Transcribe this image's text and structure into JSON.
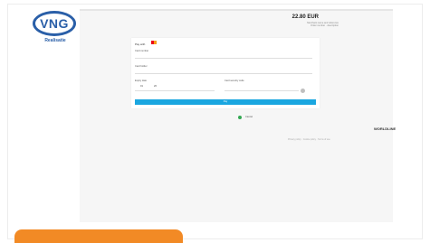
{
  "logo": {
    "letters": "VNG",
    "tagline": "Realisatie"
  },
  "payment": {
    "amount": "22.80 EUR",
    "merchant_line1": "Merchant name and reference",
    "merchant_line2": "Order number · description"
  },
  "card": {
    "pay_with_label": "Pay with",
    "card_number_label": "Card number",
    "card_holder_label": "Card holder",
    "expiry_label": "Expiry date",
    "expiry_month": "01",
    "expiry_year": "26",
    "cvc_label": "Card security code",
    "pay_button": "Pay"
  },
  "cancel_label": "Cancel",
  "brand": "WORLDLINE",
  "footer": "Privacy policy · Cookie policy · Terms of use"
}
